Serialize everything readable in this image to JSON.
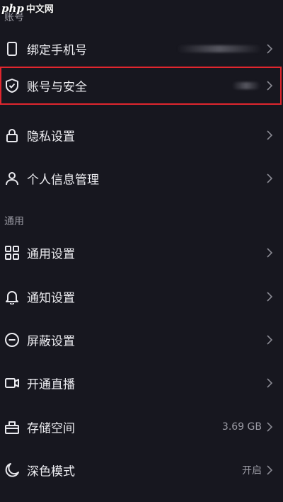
{
  "watermark": {
    "brand": "php",
    "site": "中文网"
  },
  "sections": {
    "account": "账号",
    "general": "通用"
  },
  "items": [
    {
      "label": "绑定手机号",
      "value": "",
      "icon": "phone-icon",
      "has_blur": true
    },
    {
      "label": "账号与安全",
      "value": "",
      "icon": "shield-check-icon",
      "has_blur": true,
      "highlighted": true
    },
    {
      "label": "隐私设置",
      "value": "",
      "icon": "lock-icon"
    },
    {
      "label": "个人信息管理",
      "value": "",
      "icon": "person-icon"
    },
    {
      "label": "通用设置",
      "value": "",
      "icon": "grid-icon"
    },
    {
      "label": "通知设置",
      "value": "",
      "icon": "bell-icon"
    },
    {
      "label": "屏蔽设置",
      "value": "",
      "icon": "block-icon"
    },
    {
      "label": "开通直播",
      "value": "",
      "icon": "video-camera-icon"
    },
    {
      "label": "存储空间",
      "value": "3.69 GB",
      "icon": "storage-box-icon"
    },
    {
      "label": "深色模式",
      "value": "开启",
      "icon": "moon-icon"
    }
  ],
  "colors": {
    "background": "#17171f",
    "highlight_border": "#e0262e",
    "text_primary": "#eeeef2",
    "text_secondary": "#9d9da6"
  }
}
